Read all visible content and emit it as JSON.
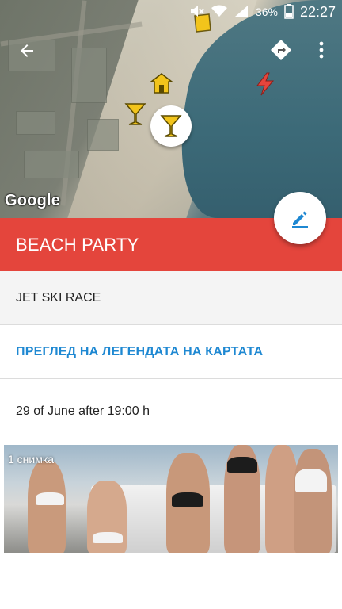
{
  "status_bar": {
    "battery_percent": "36%",
    "time": "22:27"
  },
  "map": {
    "attribution": "Google"
  },
  "place": {
    "title": "BEACH PARTY",
    "subtitle": "JET SKI RACE",
    "legend_link": "ПРЕГЛЕД НА ЛЕГЕНДАТА НА КАРТАТА",
    "date_text": "29 of June after 19:00 h"
  },
  "photos": {
    "count_label": "1 снимка"
  },
  "colors": {
    "title_bar": "#e4453c",
    "link": "#1e88d2",
    "marker_yellow": "#f2c41b",
    "fab_icon": "#1e88d2"
  }
}
